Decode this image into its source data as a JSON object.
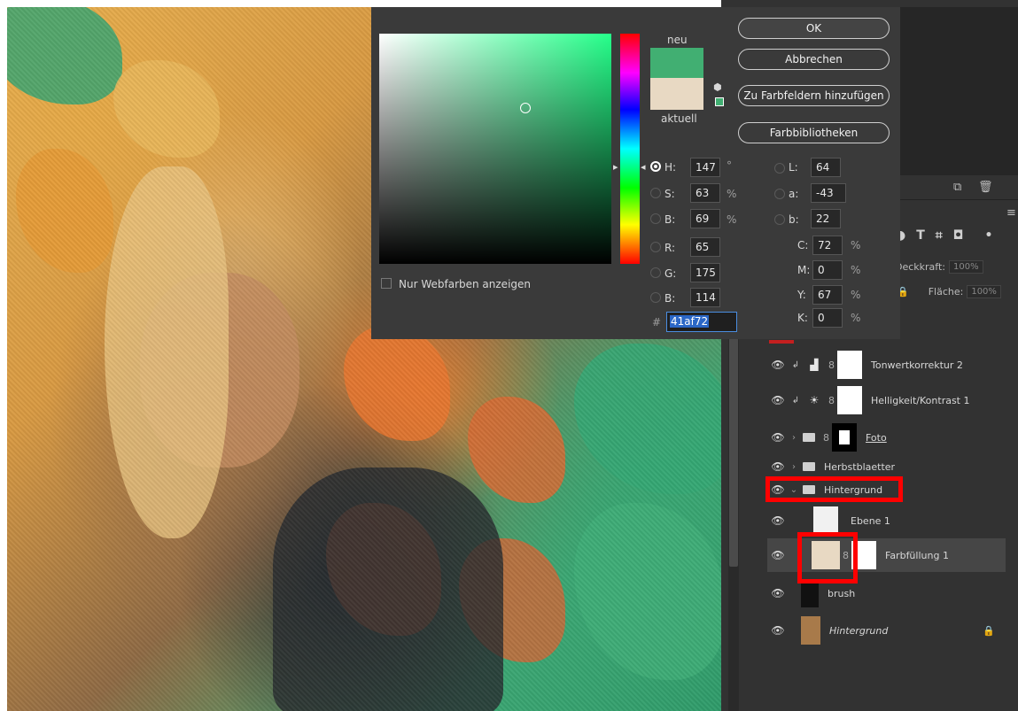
{
  "color_picker": {
    "label_new": "neu",
    "label_current": "aktuell",
    "buttons": {
      "ok": "OK",
      "cancel": "Abbrechen",
      "add_to_swatches": "Zu Farbfeldern hinzufügen",
      "color_libraries": "Farbbibliotheken"
    },
    "web_colors_label": "Nur Webfarben anzeigen",
    "new_color": "#41af72",
    "current_color": "#e8d9c3",
    "hsb": {
      "h_label": "H:",
      "h": "147",
      "h_unit": "°",
      "s_label": "S:",
      "s": "63",
      "s_unit": "%",
      "b_label": "B:",
      "b": "69",
      "b_unit": "%"
    },
    "rgb": {
      "r_label": "R:",
      "r": "65",
      "g_label": "G:",
      "g": "175",
      "b_label": "B:",
      "b": "114"
    },
    "lab": {
      "l_label": "L:",
      "l": "64",
      "a_label": "a:",
      "a": "-43",
      "b_label": "b:",
      "b": "22"
    },
    "cmyk": {
      "c_label": "C:",
      "c": "72",
      "m_label": "M:",
      "m": "0",
      "y_label": "Y:",
      "y": "67",
      "k_label": "K:",
      "k": "0",
      "unit": "%"
    },
    "hex_label": "#",
    "hex": "41af72"
  },
  "layers_panel": {
    "opacity_label": "Deckkraft:",
    "opacity_value": "100%",
    "fill_label": "Fläche:",
    "fill_value": "100%",
    "layers": [
      {
        "name": "Tonwertkorrektur 2"
      },
      {
        "name": "Helligkeit/Kontrast 1"
      },
      {
        "name": "Foto"
      },
      {
        "name": "Herbstblaetter"
      },
      {
        "name": "Hintergrund"
      },
      {
        "name": "Ebene 1"
      },
      {
        "name": "Farbfüllung 1"
      },
      {
        "name": "brush"
      },
      {
        "name": "Hintergrund"
      }
    ]
  },
  "accent_colors": {
    "highlight": "#ff0000",
    "selection": "#2b67c7"
  }
}
